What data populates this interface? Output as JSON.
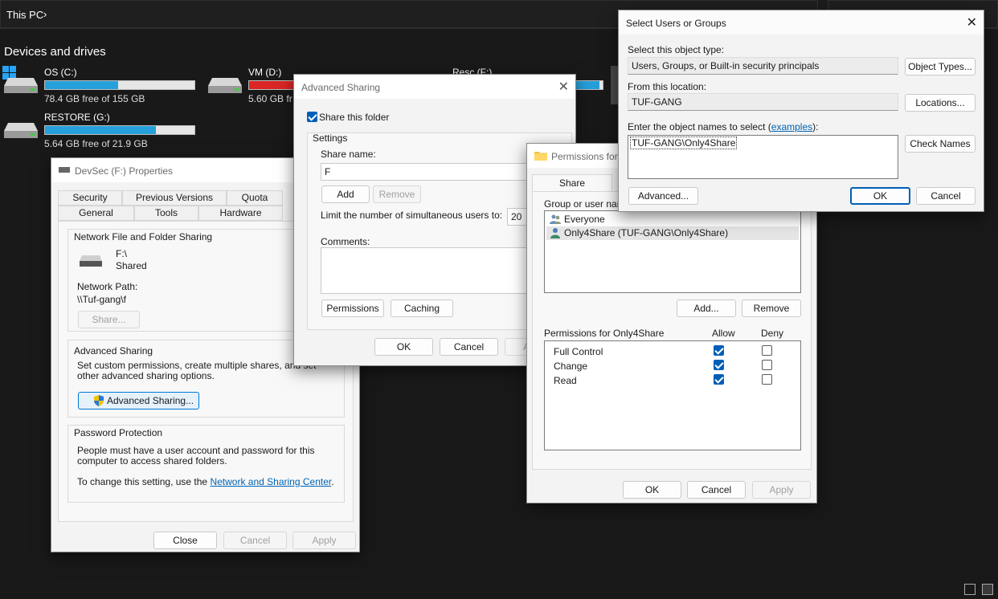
{
  "explorer": {
    "breadcrumb": "This PC",
    "section_title": "Devices and drives",
    "drives": [
      {
        "name": "OS (C:)",
        "free": "78.4 GB free of 155 GB",
        "used_fraction": 0.49,
        "color": "#26a0da"
      },
      {
        "name": "VM (D:)",
        "free": "5.60 GB fr",
        "used_fraction": 0.96,
        "color": "#da2626"
      },
      {
        "name": "Resc (F:)",
        "free": "",
        "used_fraction": 0.9,
        "color": "#26a0da"
      },
      {
        "name": "RESTORE (G:)",
        "free": "5.64 GB free of 21.9 GB",
        "used_fraction": 0.74,
        "color": "#26a0da"
      }
    ]
  },
  "properties": {
    "title": "DevSec (F:) Properties",
    "tabs_row1": [
      "Security",
      "Previous Versions",
      "Quota"
    ],
    "tabs_row2": [
      "General",
      "Tools",
      "Hardware"
    ],
    "nffs_title": "Network File and Folder Sharing",
    "share_path": "F:\\",
    "share_state": "Shared",
    "network_path_label": "Network Path:",
    "network_path": "\\\\Tuf-gang\\f",
    "share_button": "Share...",
    "adv_title": "Advanced Sharing",
    "adv_desc": "Set custom permissions, create multiple shares, and set other advanced sharing options.",
    "adv_button": "Advanced Sharing...",
    "pw_title": "Password Protection",
    "pw_desc": "People must have a user account and password for this computer to access shared folders.",
    "pw_change_prefix": "To change this setting, use the ",
    "pw_link": "Network and Sharing Center",
    "pw_suffix": ".",
    "btn_close": "Close",
    "btn_cancel": "Cancel",
    "btn_apply": "Apply"
  },
  "advanced_sharing": {
    "title": "Advanced Sharing",
    "share_checkbox": "Share this folder",
    "share_checked": true,
    "settings_label": "Settings",
    "share_name_label": "Share name:",
    "share_name_value": "F",
    "btn_add": "Add",
    "btn_remove": "Remove",
    "limit_label": "Limit the number of simultaneous users to:",
    "limit_value": "20",
    "comments_label": "Comments:",
    "btn_permissions": "Permissions",
    "btn_caching": "Caching",
    "btn_ok": "OK",
    "btn_cancel": "Cancel",
    "btn_apply": "A"
  },
  "permissions": {
    "title": "Permissions for",
    "tab": "Share Permissions",
    "group_label": "Group or user name",
    "users": [
      "Everyone",
      "Only4Share (TUF-GANG\\Only4Share)"
    ],
    "selected_user_index": 1,
    "btn_add": "Add...",
    "btn_remove": "Remove",
    "perm_label": "Permissions for Only4Share",
    "col_allow": "Allow",
    "col_deny": "Deny",
    "perms": [
      {
        "name": "Full Control",
        "allow": true,
        "deny": false
      },
      {
        "name": "Change",
        "allow": true,
        "deny": false
      },
      {
        "name": "Read",
        "allow": true,
        "deny": false
      }
    ],
    "btn_ok": "OK",
    "btn_cancel": "Cancel",
    "btn_apply": "Apply"
  },
  "select_users": {
    "title": "Select Users or Groups",
    "object_type_label": "Select this object type:",
    "object_type_value": "Users, Groups, or Built-in security principals",
    "btn_object_types": "Object Types...",
    "location_label": "From this location:",
    "location_value": "TUF-GANG",
    "btn_locations": "Locations...",
    "names_label_prefix": "Enter the object names to select (",
    "names_link": "examples",
    "names_label_suffix": "):",
    "names_value": "TUF-GANG\\Only4Share",
    "btn_check_names": "Check Names",
    "btn_advanced": "Advanced...",
    "btn_ok": "OK",
    "btn_cancel": "Cancel"
  }
}
